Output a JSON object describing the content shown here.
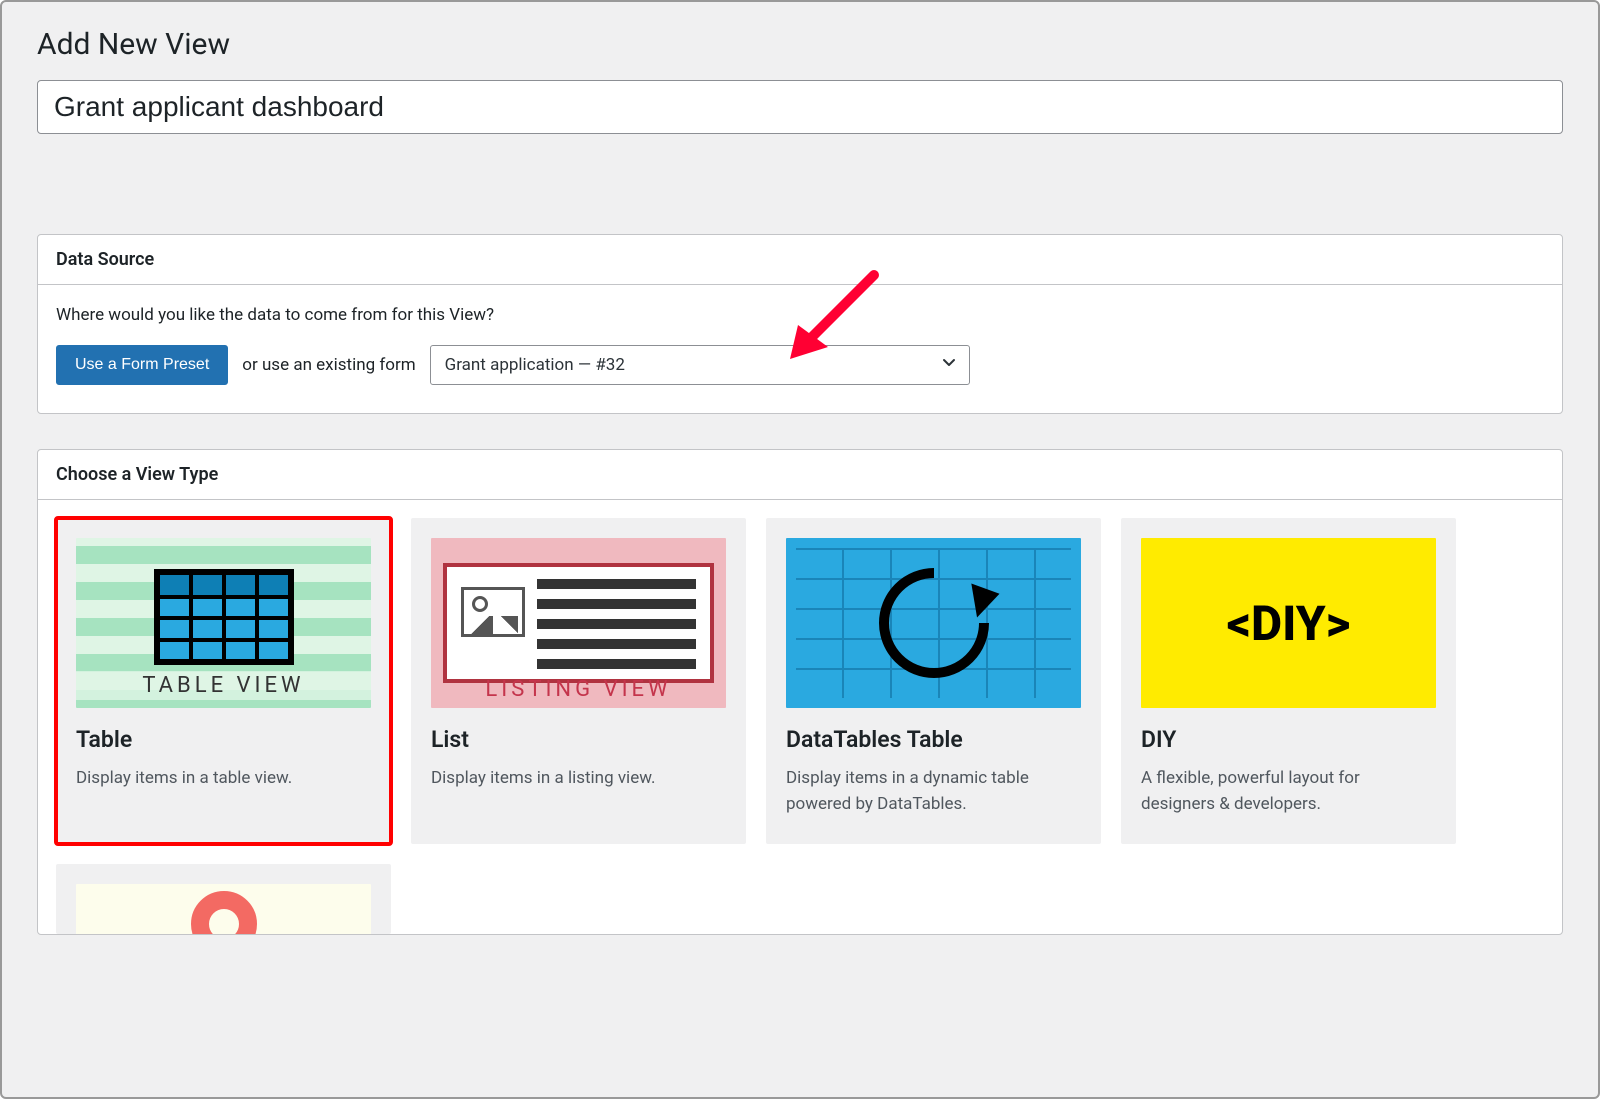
{
  "page": {
    "title": "Add New View",
    "view_name_value": "Grant applicant dashboard"
  },
  "data_source": {
    "panel_title": "Data Source",
    "prompt": "Where would you like the data to come from for this View?",
    "preset_button": "Use a Form Preset",
    "or_text": "or use an existing form",
    "selected_form": "Grant application — #32"
  },
  "view_types": {
    "panel_title": "Choose a View Type",
    "cards": [
      {
        "title": "Table",
        "desc": "Display items in a table view.",
        "thumb_label": "TABLE VIEW",
        "selected": true
      },
      {
        "title": "List",
        "desc": "Display items in a listing view.",
        "thumb_label": "LISTING VIEW",
        "selected": false
      },
      {
        "title": "DataTables Table",
        "desc": "Display items in a dynamic table powered by DataTables.",
        "thumb_label": "",
        "selected": false
      },
      {
        "title": "DIY",
        "desc": "A flexible, powerful layout for designers & developers.",
        "thumb_label": "<DIY>",
        "selected": false
      }
    ]
  },
  "annotation": {
    "arrow_color": "#ff0033"
  }
}
